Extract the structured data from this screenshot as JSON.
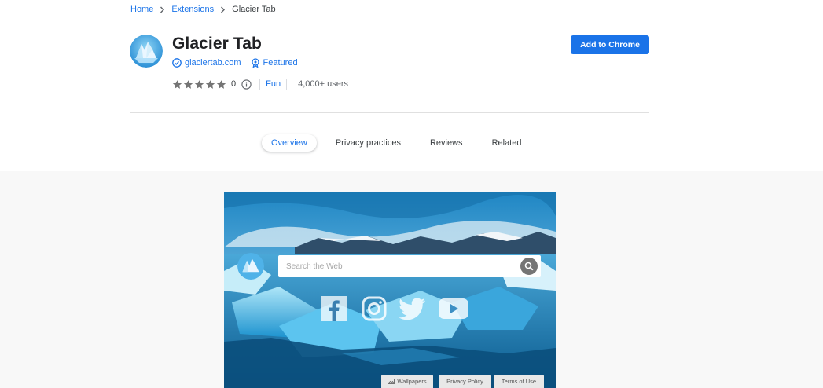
{
  "breadcrumb": {
    "home": "Home",
    "extensions": "Extensions",
    "current": "Glacier Tab"
  },
  "extension": {
    "name": "Glacier Tab",
    "site": "glaciertab.com",
    "badge": "Featured",
    "rating": "0",
    "category": "Fun",
    "users": "4,000+ users",
    "add_button": "Add to Chrome"
  },
  "tabs": [
    {
      "label": "Overview",
      "active": true
    },
    {
      "label": "Privacy practices",
      "active": false
    },
    {
      "label": "Reviews",
      "active": false
    },
    {
      "label": "Related",
      "active": false
    }
  ],
  "screenshot": {
    "search_placeholder": "Search the Web",
    "social_icons": [
      "facebook-icon",
      "instagram-icon",
      "twitter-icon",
      "youtube-icon"
    ],
    "footer_buttons": [
      "Wallpapers",
      "Privacy Policy",
      "Terms of Use"
    ]
  },
  "colors": {
    "accent": "#1a73e8",
    "star": "#757575",
    "gray_background": "#f8f8f8"
  }
}
